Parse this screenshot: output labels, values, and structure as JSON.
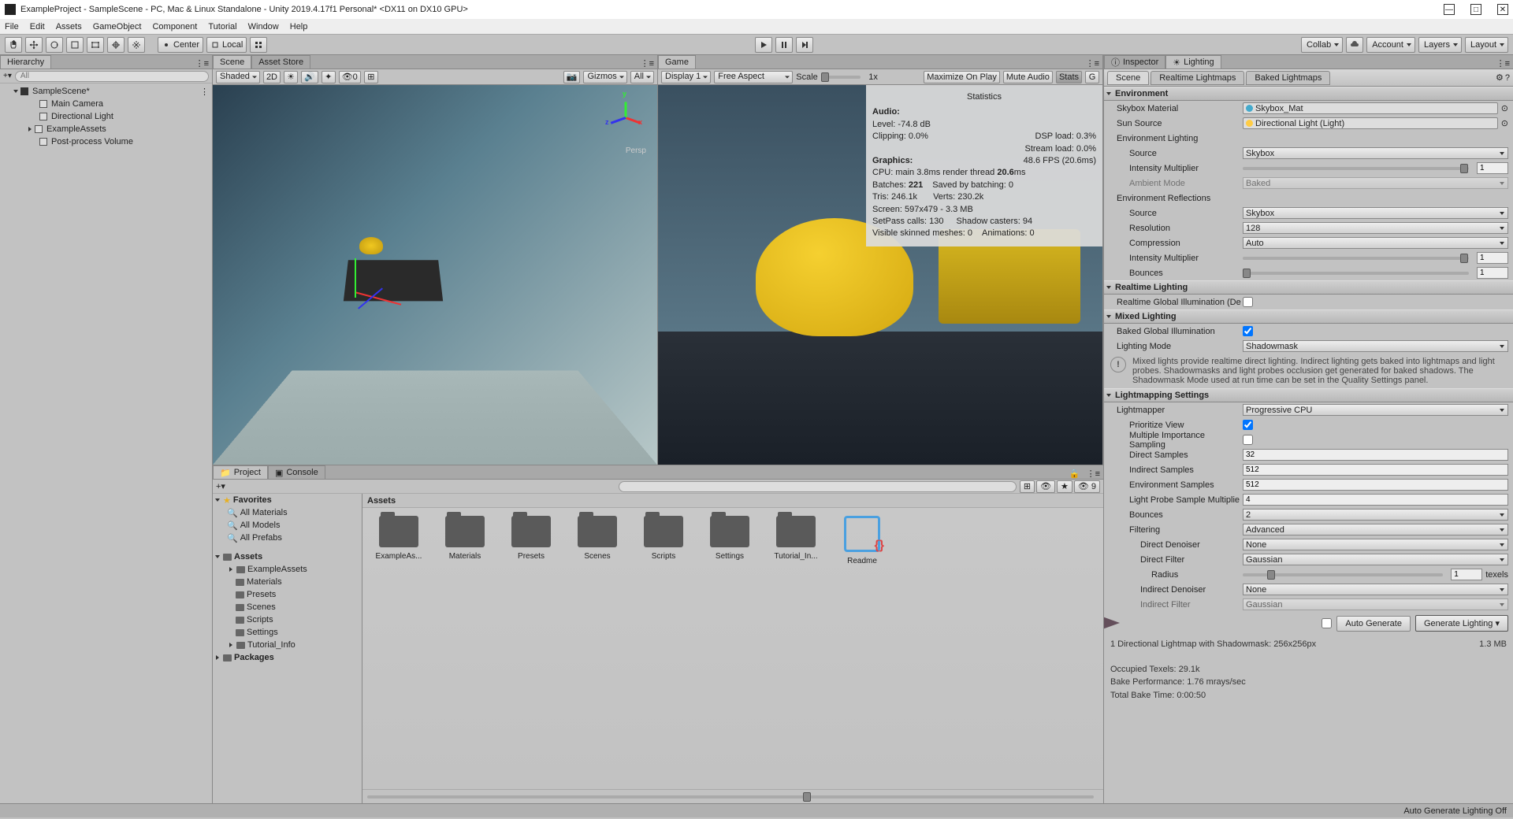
{
  "window": {
    "title": "ExampleProject - SampleScene - PC, Mac & Linux Standalone - Unity 2019.4.17f1 Personal* <DX11 on DX10 GPU>"
  },
  "menu": [
    "File",
    "Edit",
    "Assets",
    "GameObject",
    "Component",
    "Tutorial",
    "Window",
    "Help"
  ],
  "toolbar": {
    "center": "Center",
    "local": "Local",
    "collab": "Collab",
    "account": "Account",
    "layers": "Layers",
    "layout": "Layout"
  },
  "hierarchy": {
    "tab": "Hierarchy",
    "search_ph": "All",
    "items": [
      {
        "label": "SampleScene*",
        "depth": 0,
        "open": true
      },
      {
        "label": "Main Camera",
        "depth": 1
      },
      {
        "label": "Directional Light",
        "depth": 1
      },
      {
        "label": "ExampleAssets",
        "depth": 1,
        "arrow": true
      },
      {
        "label": "Post-process Volume",
        "depth": 1
      }
    ]
  },
  "scene": {
    "tab": "Scene",
    "asset_tab": "Asset Store",
    "shaded": "Shaded",
    "mode2d": "2D",
    "gizmos": "Gizmos",
    "all": "All",
    "persp": "Persp"
  },
  "game": {
    "tab": "Game",
    "display": "Display 1",
    "aspect": "Free Aspect",
    "scale": "Scale",
    "scale_val": "1x",
    "maximize": "Maximize On Play",
    "mute": "Mute Audio",
    "stats": "Stats",
    "gizmos": "G"
  },
  "stats": {
    "title": "Statistics",
    "audio_hdr": "Audio:",
    "level": "Level: -74.8 dB",
    "clipping": "Clipping: 0.0%",
    "dsp": "DSP load: 0.3%",
    "stream": "Stream load: 0.0%",
    "gfx_hdr": "Graphics:",
    "fps": "48.6 FPS (20.6ms)",
    "cpu": "CPU: main 3.8ms  render thread ",
    "cpu_bold": "20.6",
    "cpu_tail": "ms",
    "batches": "Batches: ",
    "batches_b": "221",
    "saved": "Saved by batching: 0",
    "tris": "Tris: 246.1k",
    "verts": "Verts: 230.2k",
    "screen": "Screen: 597x479 - 3.3 MB",
    "setpass": "SetPass calls: 130",
    "shadow": "Shadow casters: 94",
    "skinned": "Visible skinned meshes: 0",
    "anim": "Animations: 0"
  },
  "project": {
    "tab": "Project",
    "console": "Console",
    "assets_hdr": "Assets",
    "count": "9",
    "favorites": "Favorites",
    "fav": [
      "All Materials",
      "All Models",
      "All Prefabs"
    ],
    "assets": "Assets",
    "folders": [
      "ExampleAssets",
      "Materials",
      "Presets",
      "Scenes",
      "Scripts",
      "Settings",
      "Tutorial_Info"
    ],
    "packages": "Packages",
    "grid": [
      "ExampleAs...",
      "Materials",
      "Presets",
      "Scenes",
      "Scripts",
      "Settings",
      "Tutorial_In...",
      "Readme"
    ]
  },
  "inspector": {
    "tab_inspector": "Inspector",
    "tab_lighting": "Lighting",
    "subtabs": [
      "Scene",
      "Realtime Lightmaps",
      "Baked Lightmaps"
    ],
    "env": "Environment",
    "skybox_mat": "Skybox Material",
    "skybox_val": "Skybox_Mat",
    "sun": "Sun Source",
    "sun_val": "Directional Light (Light)",
    "env_light": "Environment Lighting",
    "source": "Source",
    "skybox": "Skybox",
    "int_mult": "Intensity Multiplier",
    "int_val": "1",
    "amb_mode": "Ambient Mode",
    "baked": "Baked",
    "env_refl": "Environment Reflections",
    "resolution": "Resolution",
    "res_val": "128",
    "compression": "Compression",
    "comp_val": "Auto",
    "bounces": "Bounces",
    "bounces_val": "1",
    "realtime": "Realtime Lighting",
    "rgi": "Realtime Global Illumination (De",
    "mixed": "Mixed Lighting",
    "bgi": "Baked Global Illumination",
    "light_mode": "Lighting Mode",
    "shadowmask": "Shadowmask",
    "mixed_info": "Mixed lights provide realtime direct lighting. Indirect lighting gets baked into lightmaps and light probes. Shadowmasks and light probes occlusion get generated for baked shadows. The Shadowmask Mode used at run time can be set in the Quality Settings panel.",
    "lm_settings": "Lightmapping Settings",
    "lightmapper": "Lightmapper",
    "lm_val": "Progressive CPU",
    "prioritize": "Prioritize View",
    "mis": "Multiple Importance Sampling",
    "direct_samples": "Direct Samples",
    "ds_val": "32",
    "indirect_samples": "Indirect Samples",
    "is_val": "512",
    "env_samples": "Environment Samples",
    "es_val": "512",
    "lp_mult": "Light Probe Sample Multiplie",
    "lp_val": "4",
    "bounces2": "Bounces",
    "b2_val": "2",
    "filtering": "Filtering",
    "filt_val": "Advanced",
    "d_denoiser": "Direct Denoiser",
    "none": "None",
    "d_filter": "Direct Filter",
    "gaussian": "Gaussian",
    "radius": "Radius",
    "radius_val": "1",
    "texels": "texels",
    "i_denoiser": "Indirect Denoiser",
    "i_filter": "Indirect Filter",
    "auto_gen": "Auto Generate",
    "gen_light": "Generate Lighting",
    "lm_info": "1 Directional Lightmap with Shadowmask: 256x256px",
    "lm_size": "1.3 MB",
    "occupied": "Occupied Texels: 29.1k",
    "bake_perf": "Bake Performance: 1.76 mrays/sec",
    "bake_time": "Total Bake Time: 0:00:50"
  },
  "statusbar": "Auto Generate Lighting Off"
}
